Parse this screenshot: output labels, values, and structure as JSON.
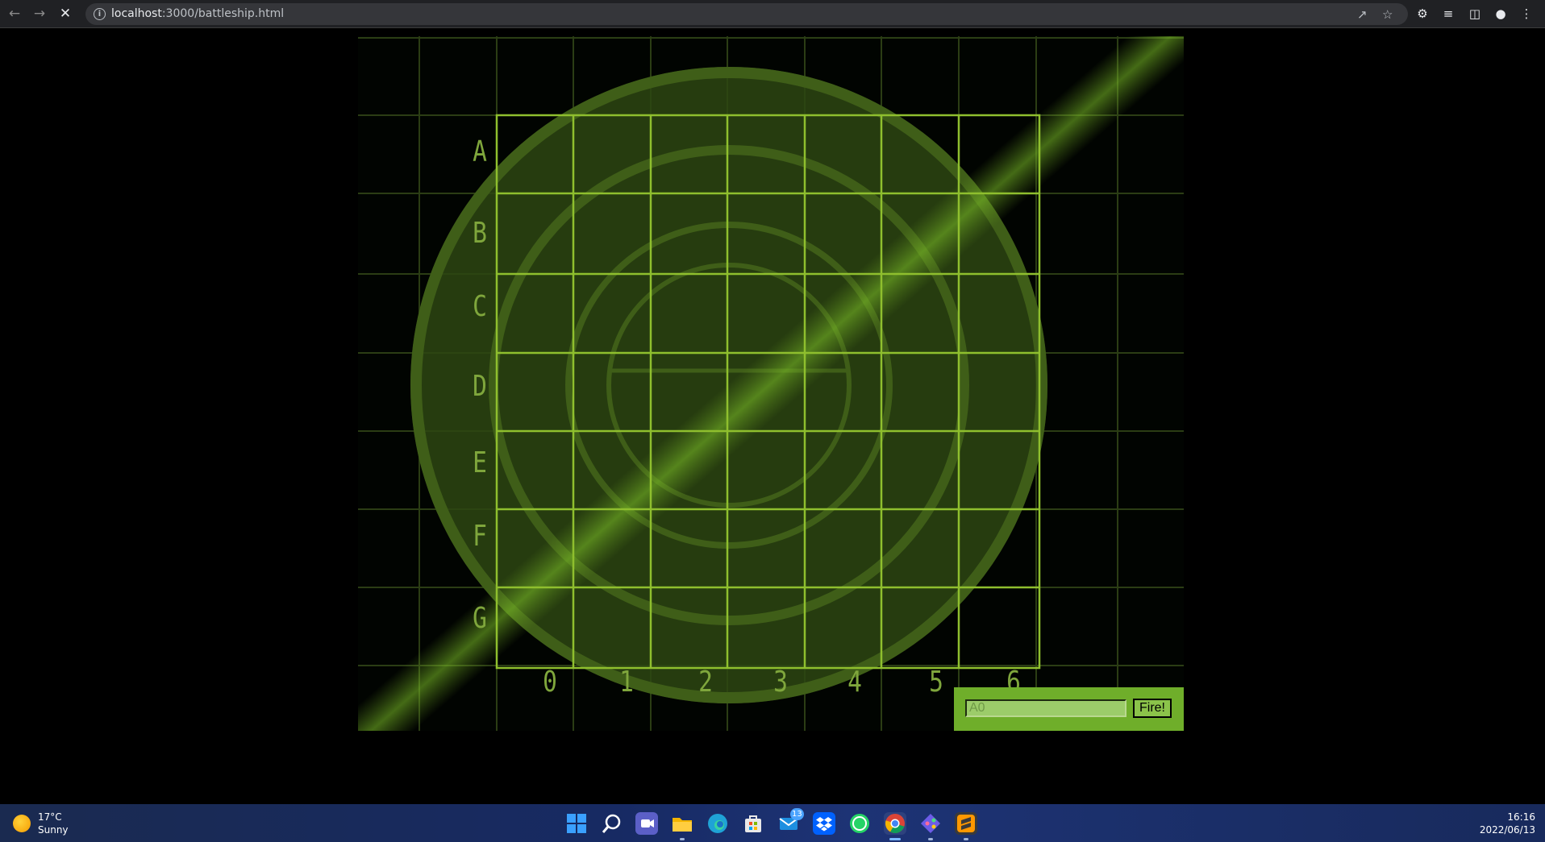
{
  "browser": {
    "url_host": "localhost",
    "url_rest": ":3000/battleship.html",
    "back_icon": "arrow-left",
    "forward_icon": "arrow-right",
    "stop_icon": "close"
  },
  "board": {
    "row_labels": [
      "A",
      "B",
      "C",
      "D",
      "E",
      "F",
      "G"
    ],
    "col_labels": [
      "0",
      "1",
      "2",
      "3",
      "4",
      "5",
      "6"
    ],
    "colors": {
      "grid_line": "#8fbf2e",
      "label": "#7fa63c",
      "ring": "#3d5a18",
      "disc": "#2d4612",
      "sweep": "#6aa020"
    }
  },
  "fire_form": {
    "input_value": "",
    "input_placeholder": "A0",
    "button_label": "Fire!",
    "panel_color": "#6fae2a"
  },
  "taskbar": {
    "weather_temp": "17°C",
    "weather_condition": "Sunny",
    "mail_badge": "13",
    "clock_time": "16:16",
    "clock_date": "2022/06/13",
    "apps": [
      "start",
      "search",
      "teams",
      "file-explorer",
      "edge",
      "store",
      "mail",
      "dropbox",
      "whatsapp",
      "chrome",
      "git",
      "sublime-text"
    ]
  }
}
